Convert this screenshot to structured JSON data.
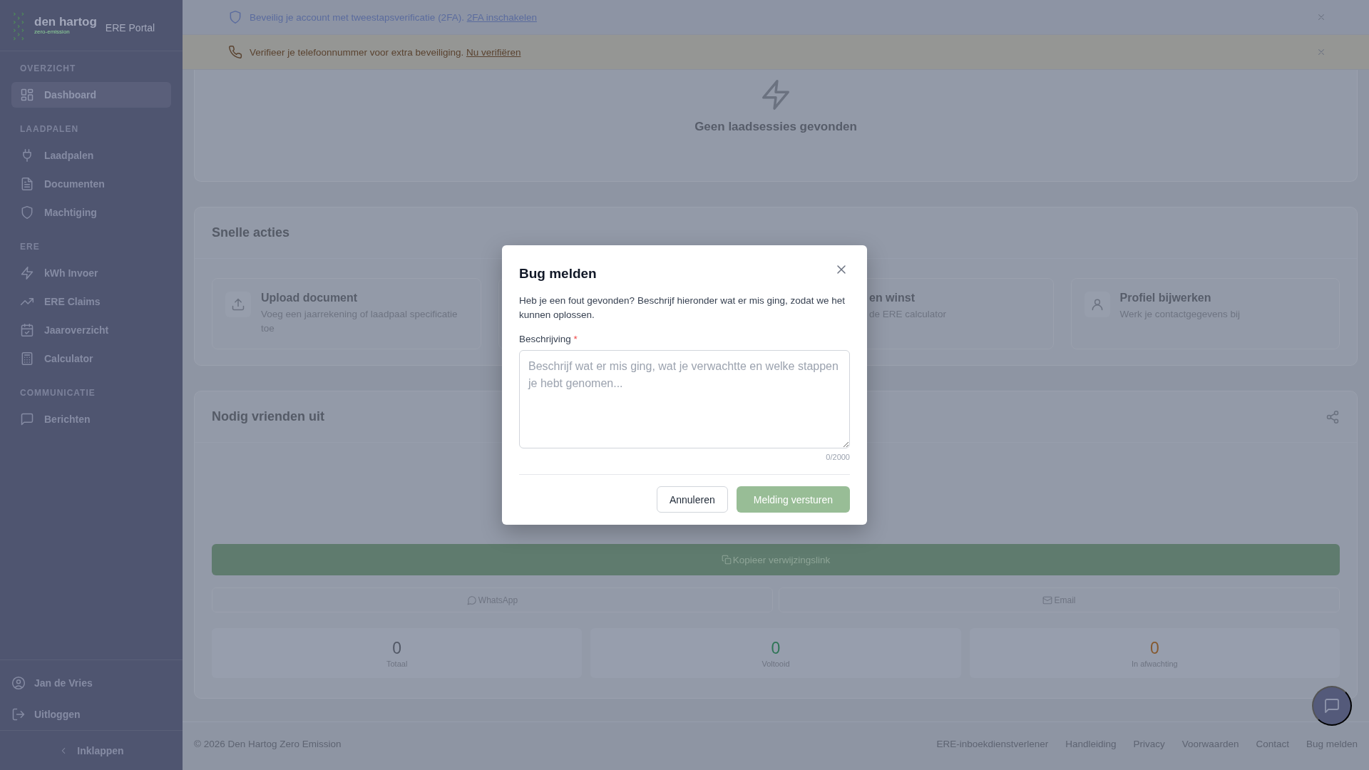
{
  "sidebar": {
    "logo": {
      "brand": "den hartog",
      "tagline": "zero-emission",
      "product": "ERE Portal"
    },
    "sections": [
      {
        "heading": "OVERZICHT",
        "items": [
          {
            "label": "Dashboard",
            "selected": true
          }
        ]
      },
      {
        "heading": "LAADPALEN",
        "items": [
          {
            "label": "Laadpalen",
            "selected": false
          },
          {
            "label": "Documenten",
            "selected": false
          },
          {
            "label": "Machtiging",
            "selected": false
          }
        ]
      },
      {
        "heading": "ERE",
        "items": [
          {
            "label": "kWh Invoer",
            "selected": false
          },
          {
            "label": "ERE Claims",
            "selected": false
          },
          {
            "label": "Jaaroverzicht",
            "selected": false
          },
          {
            "label": "Calculator",
            "selected": false
          }
        ]
      },
      {
        "heading": "COMMUNICATIE",
        "items": [
          {
            "label": "Berichten",
            "selected": false
          }
        ]
      }
    ],
    "user": "Jan de Vries",
    "logout": "Uitloggen",
    "collapse": "Inklappen"
  },
  "banners": [
    {
      "kind": "security",
      "text": "Beveilig je account met tweestapsverificatie (2FA).",
      "link": "2FA inschakelen"
    },
    {
      "kind": "phone",
      "text": "Verifieer je telefoonnummer voor extra beveiliging.",
      "link": "Nu verifiëren"
    }
  ],
  "sessions": {
    "empty_text": "Geen laadsessies gevonden"
  },
  "quick_actions": {
    "title": "Snelle acties",
    "cards": [
      {
        "kind": "full",
        "title": "Upload document",
        "description": "Voeg een jaarrekening of laadpaal specificatie toe"
      },
      {
        "kind": "covered"
      },
      {
        "kind": "partial",
        "title": "en winst",
        "description": "de ERE calculator"
      },
      {
        "kind": "full",
        "title": "Profiel bijwerken",
        "description": "Werk je contactgegevens bij"
      }
    ]
  },
  "invite": {
    "title": "Nodig vrienden uit",
    "copy_button": "Kopieer verwijzingslink",
    "share_buttons": [
      {
        "label": "WhatsApp"
      },
      {
        "label": "Email"
      }
    ],
    "stats": [
      {
        "value": "0",
        "label": "Totaal",
        "color": "#525866"
      },
      {
        "value": "0",
        "label": "Voltooid",
        "color": "#2f7556"
      },
      {
        "value": "0",
        "label": "In afwachting",
        "color": "#85592f"
      }
    ]
  },
  "footer": {
    "copyright": "© 2026 Den Hartog Zero Emission",
    "links": [
      "ERE-inboekdienstverlener",
      "Handleiding",
      "Privacy",
      "Voorwaarden",
      "Contact",
      "Bug melden"
    ]
  },
  "modal": {
    "title": "Bug melden",
    "intro": "Heb je een fout gevonden? Beschrijf hieronder wat er mis ging, zodat we het kunnen oplossen.",
    "field": {
      "label": "Beschrijving",
      "required_mark": "*",
      "placeholder": "Beschrijf wat er mis ging, wat je verwachtte en welke stappen je hebt genomen...",
      "counter": "0/2000"
    },
    "buttons": [
      {
        "kind": "secondary",
        "label": "Annuleren"
      },
      {
        "kind": "primary",
        "label": "Melding versturen"
      }
    ]
  }
}
